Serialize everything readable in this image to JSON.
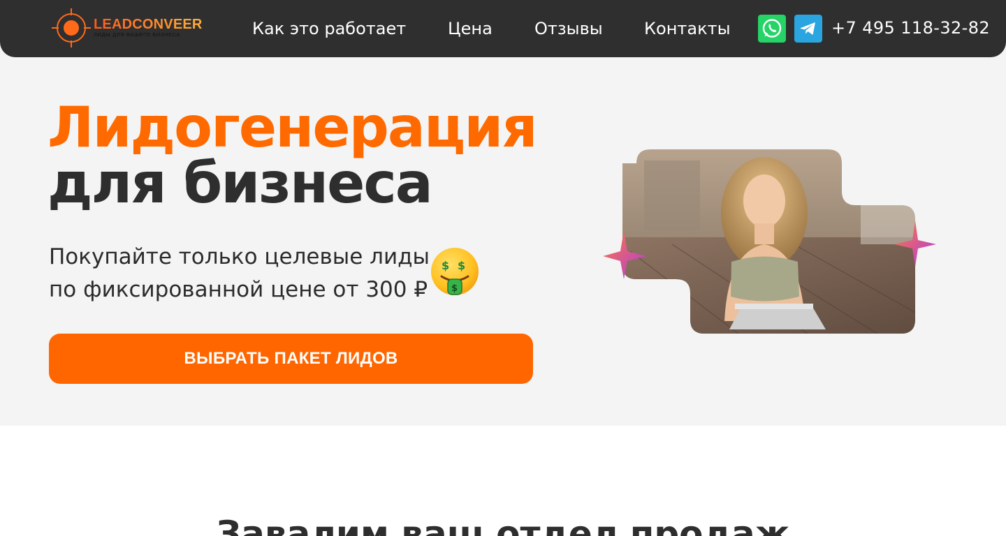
{
  "header": {
    "logo": {
      "wordmark": "LEADCONVEER",
      "tagline": "ЛИДЫ ДЛЯ ВАШЕГО БИЗНЕСА"
    },
    "nav": [
      {
        "label": "Как это работает"
      },
      {
        "label": "Цена"
      },
      {
        "label": "Отзывы"
      },
      {
        "label": "Контакты"
      }
    ],
    "messengers": [
      {
        "icon": "whatsapp-icon",
        "color": "#25d366"
      },
      {
        "icon": "telegram-icon",
        "color": "#2aa5e0"
      }
    ],
    "phone": "+7 495 118-32-82"
  },
  "hero": {
    "title_line1": "Лидогенерация",
    "title_line2": "для бизнеса",
    "subtitle_line1": "Покупайте только целевые лиды",
    "subtitle_line2": "по фиксированной цене от 300 ₽",
    "emoji_icon": "money-mouth-face-icon",
    "cta_label": "ВЫБРАТЬ ПАКЕТ ЛИДОВ"
  },
  "next_section": {
    "title": "Завалим ваш отдел продаж"
  },
  "colors": {
    "accent": "#ff6600",
    "header_bg": "#2f2f2f",
    "hero_bg": "#f4f4f4",
    "title_dark": "#2e2e2e"
  }
}
